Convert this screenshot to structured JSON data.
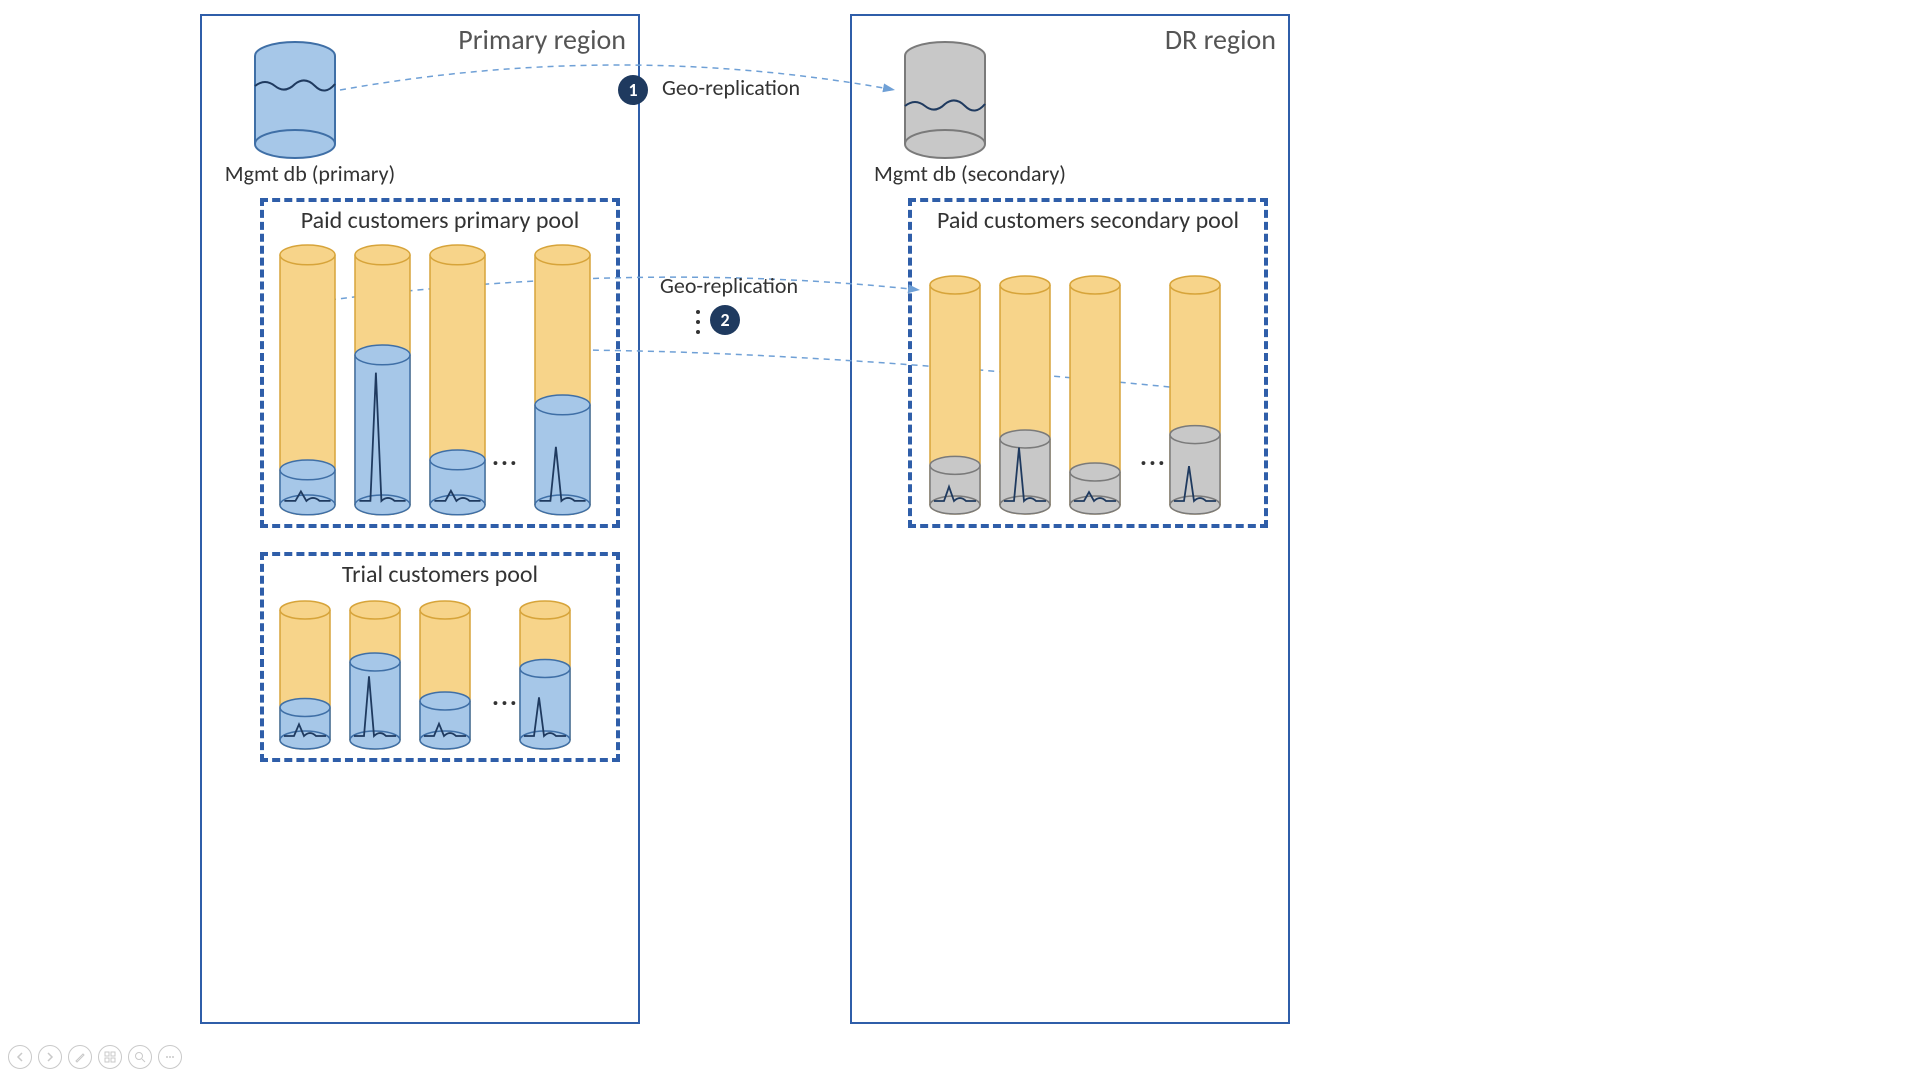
{
  "regions": {
    "primary": {
      "title": "Primary region",
      "mgmt_db_label": "Mgmt db (primary)",
      "pools": {
        "paid": {
          "title": "Paid customers primary pool"
        },
        "trial": {
          "title": "Trial customers pool"
        }
      }
    },
    "dr": {
      "title": "DR region",
      "mgmt_db_label": "Mgmt db (secondary)",
      "pools": {
        "paid": {
          "title": "Paid customers secondary pool"
        }
      }
    }
  },
  "replication": {
    "mgmt": {
      "label": "Geo-replication",
      "badge": "1"
    },
    "pool": {
      "label": "Geo-replication",
      "badge": "2"
    }
  },
  "ellipsis": "...",
  "colors": {
    "region_border": "#2f5ea9",
    "pool_border": "#2f5ea9",
    "tube_outer": "#f7d48a",
    "tube_outer_stroke": "#d7a43a",
    "primary_fill": "#a6c7e8",
    "primary_stroke": "#3f6fa6",
    "secondary_fill": "#c8c8c8",
    "secondary_stroke": "#7a7a7a",
    "badge_bg": "#1f3a5f",
    "arrow": "#6fa0d6",
    "mgmt_primary_fill": "#a6c7e8",
    "mgmt_primary_stroke": "#3f6fa6",
    "mgmt_secondary_fill": "#c8c8c8",
    "mgmt_secondary_stroke": "#7a7a7a"
  },
  "pool_data": {
    "primary_paid": {
      "fill_ratios": [
        0.14,
        0.6,
        0.18,
        0.4
      ],
      "tube_h": 250,
      "tube_w": 55,
      "spark": [
        0.3,
        0.95,
        0.25,
        0.6
      ]
    },
    "primary_trial": {
      "fill_ratios": [
        0.25,
        0.6,
        0.3,
        0.55
      ],
      "tube_h": 130,
      "tube_w": 50,
      "spark": [
        0.4,
        0.85,
        0.35,
        0.6
      ]
    },
    "dr_paid": {
      "fill_ratios": [
        0.18,
        0.3,
        0.15,
        0.32
      ],
      "tube_h": 220,
      "tube_w": 50,
      "spark": [
        0.4,
        0.9,
        0.3,
        0.55
      ]
    }
  }
}
